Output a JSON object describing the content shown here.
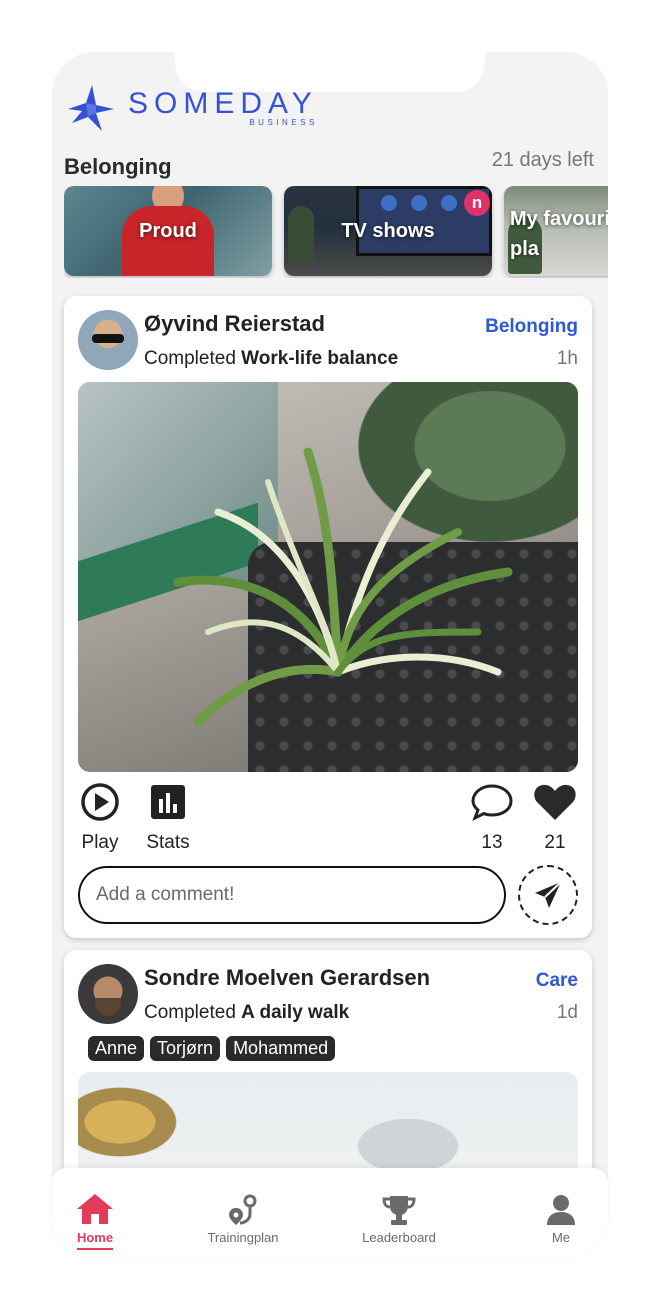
{
  "brand": {
    "name": "SOMEDAY",
    "sub": "BUSINESS",
    "color": "#3551d6"
  },
  "header": {
    "section_title": "Belonging",
    "days_left": "21 days left"
  },
  "categories": [
    {
      "label": "Proud"
    },
    {
      "label": "TV shows",
      "badge": "n"
    },
    {
      "label": "My favouri\npla"
    }
  ],
  "posts": [
    {
      "user_name": "Øyvind Reierstad",
      "completed_prefix": "Completed",
      "activity": "Work-life balance",
      "category": "Belonging",
      "time_ago": "1h",
      "actions": {
        "play": "Play",
        "stats": "Stats",
        "comments": "13",
        "likes": "21"
      },
      "comment_placeholder": "Add a comment!"
    },
    {
      "user_name": "Sondre Moelven Gerardsen",
      "completed_prefix": "Completed",
      "activity": "A daily walk",
      "category": "Care",
      "time_ago": "1d",
      "tags": [
        "Anne",
        "Torjørn",
        "Mohammed"
      ]
    }
  ],
  "nav": {
    "items": [
      {
        "label": "Home",
        "icon": "home-icon",
        "active": true
      },
      {
        "label": "Trainingplan",
        "icon": "route-icon"
      },
      {
        "label": "Leaderboard",
        "icon": "trophy-icon"
      },
      {
        "label": "Me",
        "icon": "user-icon"
      }
    ],
    "active_color": "#e23b5c"
  }
}
